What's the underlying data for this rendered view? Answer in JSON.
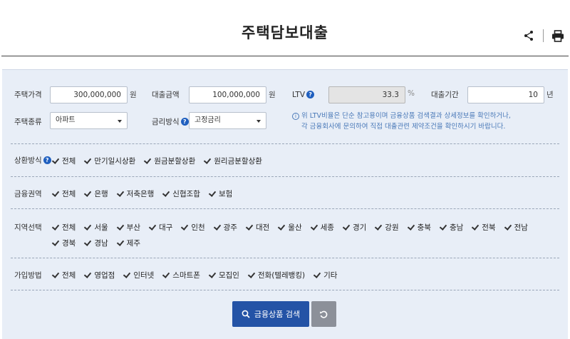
{
  "title": "주택담보대출",
  "form": {
    "house_price": {
      "label": "주택가격",
      "value": "300,000,000",
      "unit": "원"
    },
    "loan_amount": {
      "label": "대출금액",
      "value": "100,000,000",
      "unit": "원"
    },
    "ltv": {
      "label": "LTV",
      "value": "33.3",
      "unit": "%"
    },
    "loan_period": {
      "label": "대출기간",
      "value": "10",
      "unit": "년"
    },
    "house_type": {
      "label": "주택종류",
      "selected": "아파트"
    },
    "rate_type": {
      "label": "금리방식",
      "selected": "고정금리"
    },
    "notice_line1": "위 LTV비율은 단순 참고용이며 금융상품 검색결과 상세정보를 확인하거나,",
    "notice_line2": "각 금융회사에 문의하여 직접 대출관련 제약조건을 확인하시기 바랍니다."
  },
  "repayment": {
    "label": "상환방식",
    "options": [
      "전체",
      "만기일시상환",
      "원금분할상환",
      "원리금분할상환"
    ]
  },
  "sector": {
    "label": "금융권역",
    "options": [
      "전체",
      "은행",
      "저축은행",
      "신협조합",
      "보험"
    ]
  },
  "region": {
    "label": "지역선택",
    "options": [
      "전체",
      "서울",
      "부산",
      "대구",
      "인천",
      "광주",
      "대전",
      "울산",
      "세종",
      "경기",
      "강원",
      "충북",
      "충남",
      "전북",
      "전남",
      "경북",
      "경남",
      "제주"
    ]
  },
  "join": {
    "label": "가입방법",
    "options": [
      "전체",
      "영업점",
      "인터넷",
      "스마트폰",
      "모집인",
      "전화(텔레뱅킹)",
      "기타"
    ]
  },
  "buttons": {
    "search": "금융상품 검색"
  },
  "colors": {
    "primary": "#2453a6",
    "panel_bg": "#e8eef7",
    "notice": "#4a79b8",
    "reset": "#8c9099"
  }
}
